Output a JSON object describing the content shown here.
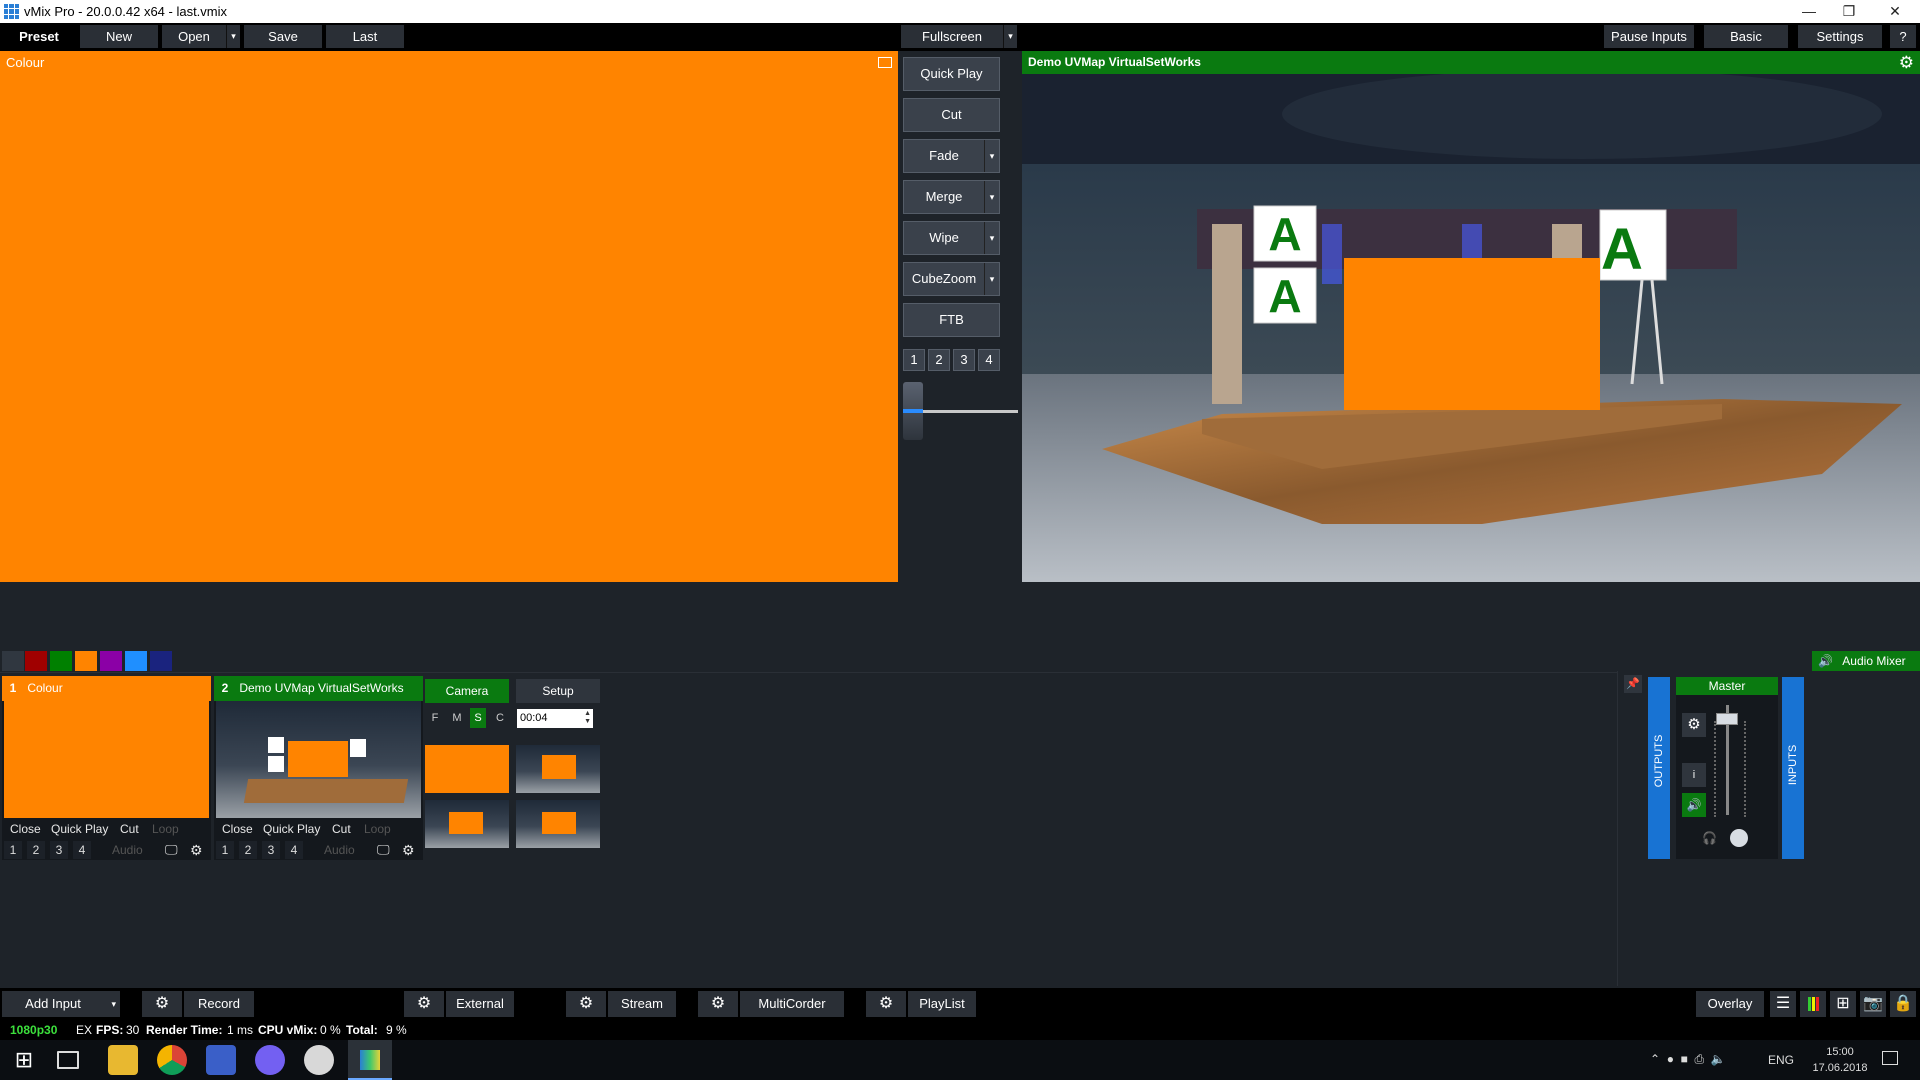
{
  "window": {
    "title": "vMix Pro - 20.0.0.42 x64 - last.vmix"
  },
  "toolbar": {
    "preset": "Preset",
    "new": "New",
    "open": "Open",
    "save": "Save",
    "last": "Last",
    "fullscreen": "Fullscreen",
    "pause_inputs": "Pause Inputs",
    "basic": "Basic",
    "settings": "Settings",
    "help": "?"
  },
  "preview": {
    "title": "Colour",
    "color": "#ff8400"
  },
  "output": {
    "title": "Demo UVMap VirtualSetWorks",
    "sign_letter": "A"
  },
  "transitions": {
    "quick_play": "Quick Play",
    "cut": "Cut",
    "fade": "Fade",
    "merge": "Merge",
    "wipe": "Wipe",
    "cubezoom": "CubeZoom",
    "ftb": "FTB",
    "numbers": [
      "1",
      "2",
      "3",
      "4"
    ],
    "tbar_position": 0
  },
  "color_swatches": [
    "#303740",
    "#a00000",
    "#008000",
    "#ff8400",
    "#8b00a6",
    "#1f8fff",
    "#1a237e"
  ],
  "inputs": [
    {
      "number": "1",
      "title": "Colour",
      "head_color": "#ff8400",
      "controls": {
        "close": "Close",
        "quick_play": "Quick Play",
        "cut": "Cut",
        "loop": "Loop"
      },
      "overlays": [
        "1",
        "2",
        "3",
        "4"
      ],
      "audio": "Audio"
    },
    {
      "number": "2",
      "title": "Demo UVMap VirtualSetWorks",
      "head_color": "#0a7a10",
      "controls": {
        "close": "Close",
        "quick_play": "Quick Play",
        "cut": "Cut",
        "loop": "Loop"
      },
      "overlays": [
        "1",
        "2",
        "3",
        "4"
      ],
      "audio": "Audio"
    }
  ],
  "virtualset": {
    "camera": "Camera",
    "setup": "Setup",
    "modes": [
      "F",
      "M",
      "S",
      "C"
    ],
    "active_mode": "S",
    "time": "00:04"
  },
  "audio_mixer": {
    "title": "Audio Mixer",
    "master": "Master",
    "outputs": "OUTPUTS",
    "inputs": "INPUTS",
    "info": "i"
  },
  "bottombar": {
    "add_input": "Add Input",
    "record": "Record",
    "external": "External",
    "stream": "Stream",
    "multicorder": "MultiCorder",
    "playlist": "PlayList",
    "overlay": "Overlay"
  },
  "status": {
    "format": "1080p30",
    "ex": "EX",
    "fps_label": "FPS:",
    "fps": "30",
    "render_label": "Render Time:",
    "render": "1 ms",
    "cpu_label": "CPU vMix:",
    "cpu": "0 %",
    "total_label": "Total:",
    "total": "9 %"
  },
  "taskbar": {
    "language": "ENG",
    "time": "15:00",
    "date": "17.06.2018"
  }
}
